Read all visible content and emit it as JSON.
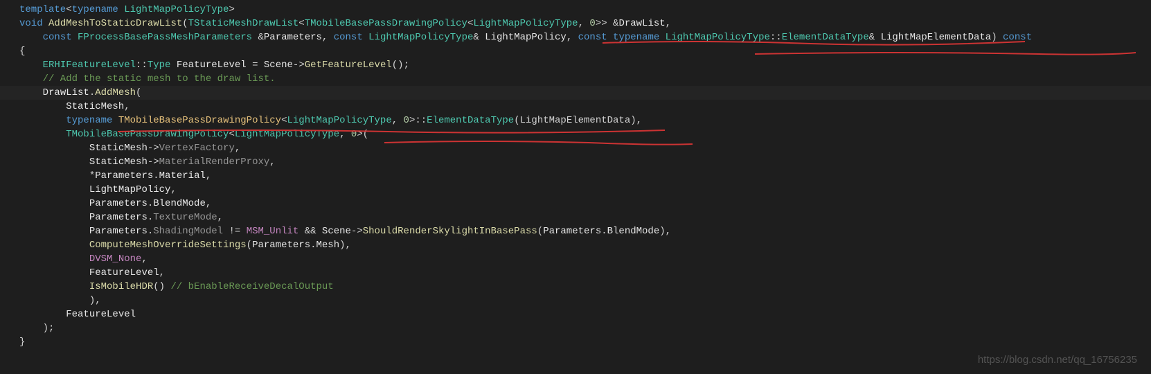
{
  "code": {
    "l1": {
      "template": "template",
      "lt": "<",
      "typename": "typename",
      "space": " ",
      "type": "LightMapPolicyType",
      "gt": ">"
    },
    "l2": {
      "void": "void",
      "sp": " ",
      "func": "AddMeshToStaticDrawList",
      "op": "(",
      "t1": "TStaticMeshDrawList",
      "lt1": "<",
      "t2": "TMobileBasePassDrawingPolicy",
      "lt2": "<",
      "lmpt": "LightMapPolicyType",
      "c1": ", ",
      "zero": "0",
      "gt1": ">>",
      "amp": " &",
      "dl": "DrawList",
      "comma": ","
    },
    "l3": {
      "indent": "    ",
      "const1": "const",
      "sp1": " ",
      "t1": "FProcessBasePassMeshParameters",
      "sp2": " &",
      "p1": "Parameters",
      "c1": ", ",
      "const2": "const",
      "sp3": " ",
      "t2": "LightMapPolicyType",
      "amp1": "& ",
      "p2": "LightMapPolicy",
      "c2": ", ",
      "const3": "const",
      "sp4": " ",
      "typename": "typename",
      "sp5": " ",
      "t3": "LightMapPolicyType",
      "cc": "::",
      "edt": "ElementDataType",
      "amp2": "& ",
      "p3": "LightMapElementData",
      "cp": ")",
      "sp6": " ",
      "const4": "const"
    },
    "l4": "{",
    "l5": {
      "indent": "    ",
      "t1": "ERHIFeatureLevel",
      "cc": "::",
      "t2": "Type",
      "sp": " ",
      "v": "FeatureLevel",
      "eq": " = ",
      "scene": "Scene",
      "arrow": "->",
      "call": "GetFeatureLevel",
      "paren": "();"
    },
    "l6": "    // Add the static mesh to the draw list.",
    "l7": {
      "indent": "    ",
      "dl": "DrawList",
      "dot": ".",
      "add": "AddMesh",
      "op": "("
    },
    "l8": {
      "indent": "        ",
      "sm": "StaticMesh",
      "c": ","
    },
    "l9": {
      "indent": "        ",
      "typename": "typename",
      "sp": " ",
      "t1": "TMobileBasePassDrawingPolicy",
      "lt": "<",
      "lmpt": "LightMapPolicyType",
      "c1": ", ",
      "zero": "0",
      "gt": ">",
      "cc": "::",
      "edt": "ElementDataType",
      "op": "(",
      "lmed": "LightMapElementData",
      "cp": "),"
    },
    "l10": {
      "indent": "        ",
      "t1": "TMobileBasePassDrawingPolicy",
      "lt": "<",
      "lmpt": "LightMapPolicyType",
      "c1": ", ",
      "zero": "0",
      "gt": ">",
      "op": "("
    },
    "l11": {
      "indent": "            ",
      "sm": "StaticMesh",
      "arrow": "->",
      "vf": "VertexFactory",
      "c": ","
    },
    "l12": {
      "indent": "            ",
      "sm": "StaticMesh",
      "arrow": "->",
      "mrp": "MaterialRenderProxy",
      "c": ","
    },
    "l13": {
      "indent": "            ",
      "star": "*",
      "p": "Parameters",
      "dot": ".",
      "m": "Material",
      "c": ","
    },
    "l14": {
      "indent": "            ",
      "lmp": "LightMapPolicy",
      "c": ","
    },
    "l15": {
      "indent": "            ",
      "p": "Parameters",
      "dot": ".",
      "bm": "BlendMode",
      "c": ","
    },
    "l16": {
      "indent": "            ",
      "p": "Parameters",
      "dot": ".",
      "tm": "TextureMode",
      "c": ","
    },
    "l17": {
      "indent": "            ",
      "p": "Parameters",
      "dot1": ".",
      "sm": "ShadingModel",
      "neq": " != ",
      "msm": "MSM_Unlit",
      "and": " && ",
      "scene": "Scene",
      "arrow": "->",
      "call": "ShouldRenderSkylightInBasePass",
      "op": "(",
      "p2": "Parameters",
      "dot2": ".",
      "bm": "BlendMode",
      "cp": "),"
    },
    "l18": {
      "indent": "            ",
      "call": "ComputeMeshOverrideSettings",
      "op": "(",
      "p": "Parameters",
      "dot": ".",
      "m": "Mesh",
      "cp": "),"
    },
    "l19": {
      "indent": "            ",
      "dvsm": "DVSM_None",
      "c": ","
    },
    "l20": {
      "indent": "            ",
      "fl": "FeatureLevel",
      "c": ","
    },
    "l21": {
      "indent": "            ",
      "call": "IsMobileHDR",
      "paren": "()",
      "sp": " ",
      "comment": "// bEnableReceiveDecalOutput"
    },
    "l22": "            ),",
    "l23": {
      "indent": "        ",
      "fl": "FeatureLevel"
    },
    "l24": "    );",
    "l25": "}"
  },
  "watermark": "https://blog.csdn.net/qq_16756235"
}
